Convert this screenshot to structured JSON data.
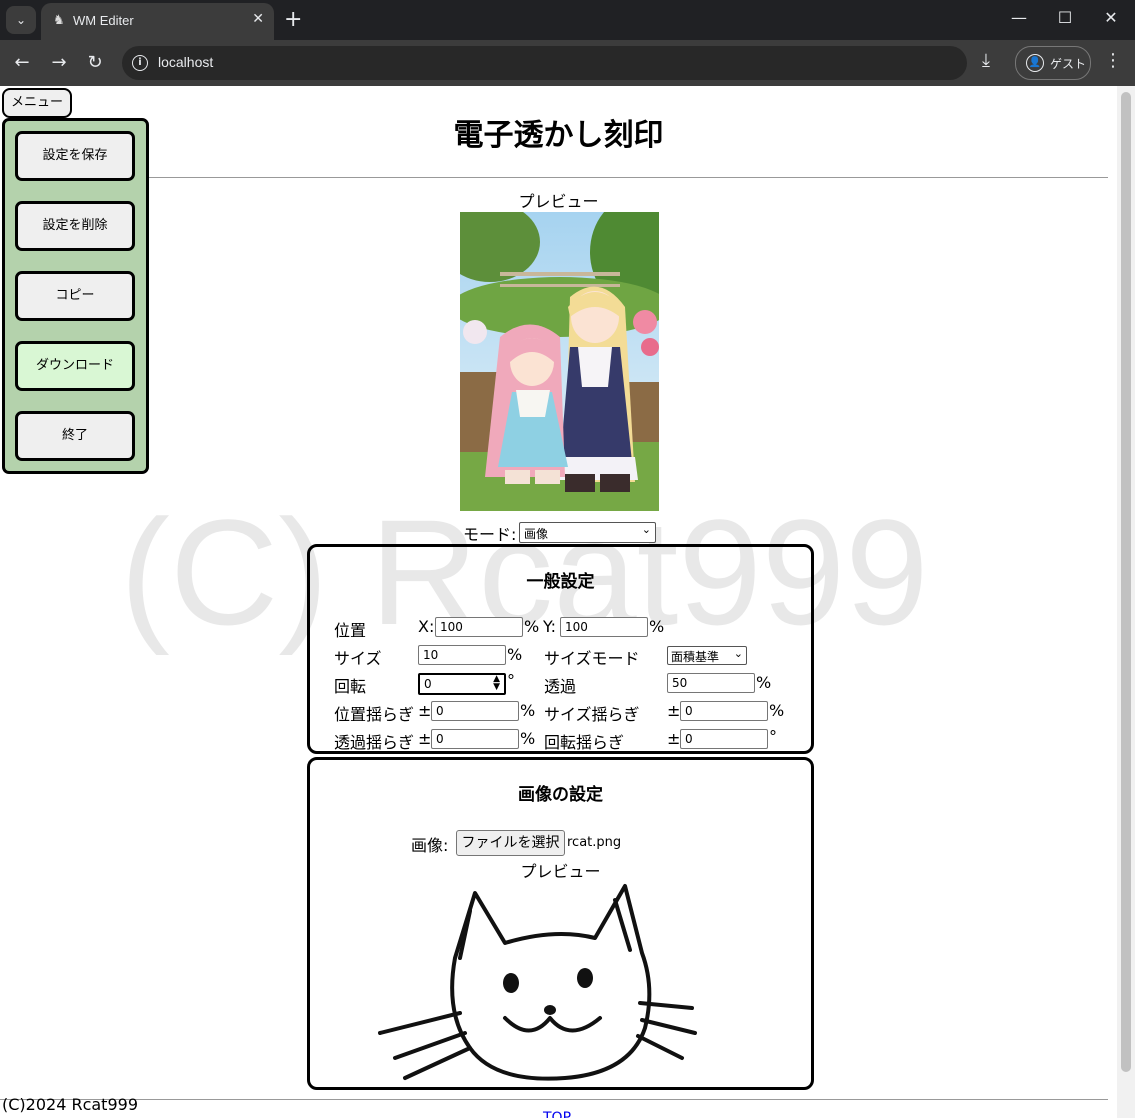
{
  "browser": {
    "tab_title": "WM Editer",
    "url": "localhost",
    "guest_label": "ゲスト",
    "tab_dropdown_icon": "chevron-down-icon",
    "new_tab_icon": "plus-icon"
  },
  "page": {
    "title": "電子透かし刻印",
    "watermark_text": "(C) Rcat999",
    "preview_label": "プレビュー",
    "mode_label": "モード:",
    "mode_value": "画像"
  },
  "menu": {
    "toggle_label": "メニュー",
    "items": [
      {
        "label": "設定を保存"
      },
      {
        "label": "設定を削除"
      },
      {
        "label": "コピー"
      },
      {
        "label": "ダウンロード"
      },
      {
        "label": "終了"
      }
    ],
    "highlight_color": "#d9f7d4",
    "panel_color": "#b4d2ac"
  },
  "general": {
    "title": "一般設定",
    "position_label": "位置",
    "x_label": "X:",
    "x_value": "100",
    "x_unit": "%",
    "y_label": "Y:",
    "y_value": "100",
    "y_unit": "%",
    "size_label": "サイズ",
    "size_value": "10",
    "size_unit": "%",
    "size_mode_label": "サイズモード",
    "size_mode_value": "面積基準",
    "rotation_label": "回転",
    "rotation_value": "0",
    "rotation_unit": "°",
    "opacity_label": "透過",
    "opacity_value": "50",
    "opacity_unit": "%",
    "pos_jitter_label": "位置揺らぎ",
    "pos_jitter_pm": "±",
    "pos_jitter_value": "0",
    "pos_jitter_unit": "%",
    "size_jitter_label": "サイズ揺らぎ",
    "size_jitter_pm": "±",
    "size_jitter_value": "0",
    "size_jitter_unit": "%",
    "opacity_jitter_label": "透過揺らぎ",
    "opacity_jitter_pm": "±",
    "opacity_jitter_value": "0",
    "opacity_jitter_unit": "%",
    "rotation_jitter_label": "回転揺らぎ",
    "rotation_jitter_pm": "±",
    "rotation_jitter_value": "0",
    "rotation_jitter_unit": "°"
  },
  "image_settings": {
    "title": "画像の設定",
    "image_label": "画像:",
    "file_button_label": "ファイルを選択",
    "file_name": "rcat.png",
    "preview_label": "プレビュー"
  },
  "footer": {
    "copyright": "(C)2024 Rcat999",
    "top_link": "TOP"
  }
}
